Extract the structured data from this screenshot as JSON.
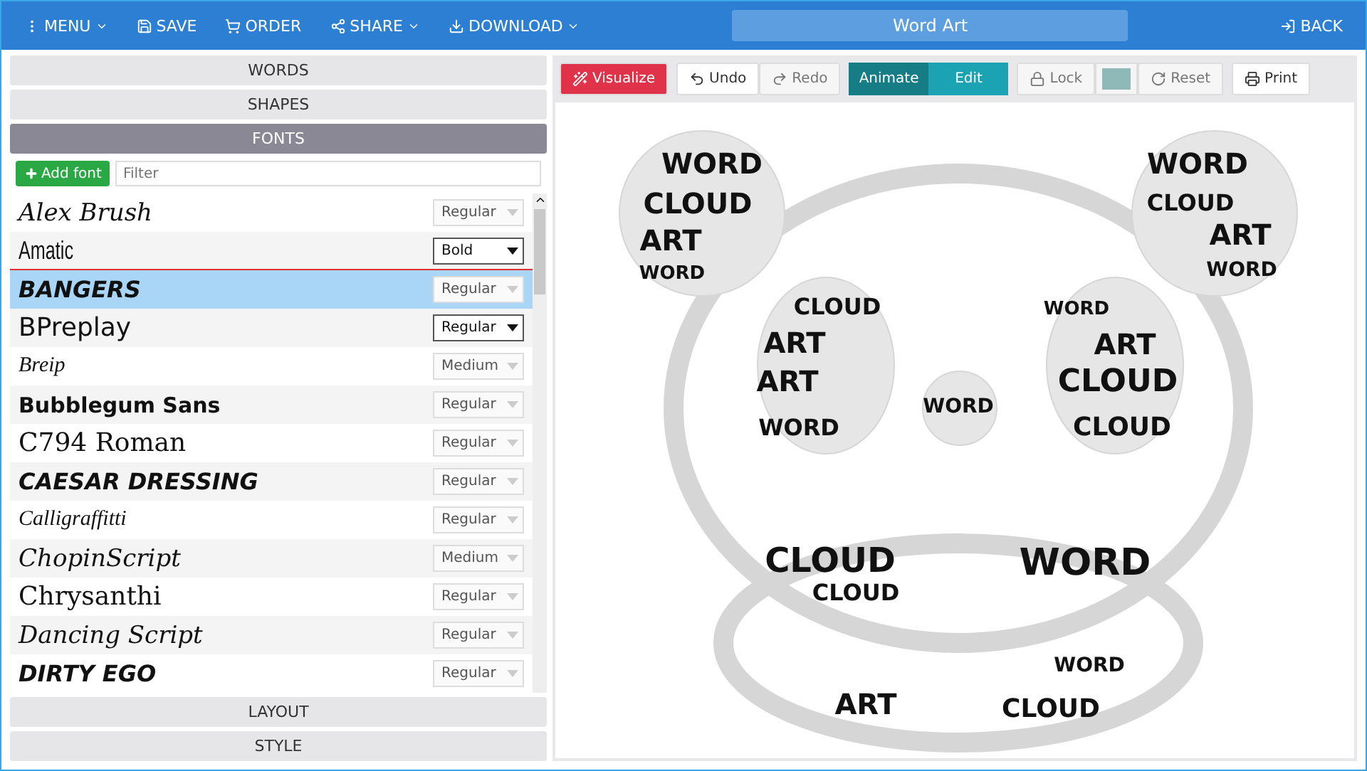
{
  "top_bar": {
    "menu": [
      {
        "label": "MENU",
        "caret": true
      },
      {
        "label": "SAVE",
        "caret": false
      },
      {
        "label": "ORDER",
        "caret": false
      },
      {
        "label": "SHARE",
        "caret": true
      },
      {
        "label": "DOWNLOAD",
        "caret": true
      }
    ],
    "title": "Word Art",
    "back": "BACK"
  },
  "sections_top": [
    {
      "label": "WORDS",
      "expanded": false
    },
    {
      "label": "SHAPES",
      "expanded": false
    },
    {
      "label": "FONTS",
      "expanded": true
    }
  ],
  "fonts_panel": {
    "add_button": "Add font",
    "filter": {
      "placeholder": "Filter"
    },
    "fonts": [
      {
        "name": "Alex Brush",
        "kind": "script",
        "weight": "Regular",
        "selected": false,
        "disabled": true
      },
      {
        "name": "Amatic",
        "kind": "narrow",
        "weight": "Bold",
        "selected": false,
        "disabled": false
      },
      {
        "name": "BANGERS",
        "kind": "display",
        "weight": "Regular",
        "selected": true,
        "disabled": true
      },
      {
        "name": "BPreplay",
        "kind": "sans",
        "weight": "Regular",
        "selected": false,
        "disabled": false
      },
      {
        "name": "Breip",
        "kind": "hand",
        "weight": "Medium",
        "selected": false,
        "disabled": true
      },
      {
        "name": "Bubblegum Sans",
        "kind": "bold",
        "weight": "Regular",
        "selected": false,
        "disabled": true
      },
      {
        "name": "C794 Roman",
        "kind": "serif",
        "weight": "Regular",
        "selected": false,
        "disabled": true
      },
      {
        "name": "CAESAR DRESSING",
        "kind": "display",
        "weight": "Regular",
        "selected": false,
        "disabled": true
      },
      {
        "name": "Calligraffitti",
        "kind": "hand",
        "weight": "Regular",
        "selected": false,
        "disabled": true
      },
      {
        "name": "ChopinScript",
        "kind": "script",
        "weight": "Medium",
        "selected": false,
        "disabled": true
      },
      {
        "name": "Chrysanthi",
        "kind": "serif",
        "weight": "Regular",
        "selected": false,
        "disabled": true
      },
      {
        "name": "Dancing Script",
        "kind": "script",
        "weight": "Regular",
        "selected": false,
        "disabled": true
      },
      {
        "name": "DIRTY EGO",
        "kind": "display",
        "weight": "Regular",
        "selected": false,
        "disabled": true
      }
    ]
  },
  "sections_bottom": [
    {
      "label": "LAYOUT",
      "expanded": false
    },
    {
      "label": "STYLE",
      "expanded": false
    }
  ],
  "toolbar": {
    "visualize": "Visualize",
    "undo": "Undo",
    "redo": "Redo",
    "modes": [
      {
        "label": "Animate",
        "selected": true
      },
      {
        "label": "Edit",
        "selected": false
      }
    ],
    "lock": "Lock",
    "reset": "Reset",
    "print": "Print"
  },
  "canvas": {
    "words": [
      "WORD",
      "WORD",
      "CLOUD",
      "CLOUD",
      "ART",
      "ART",
      "WORD",
      "WORD",
      "CLOUD",
      "WORD",
      "ART",
      "ART",
      "ART",
      "CLOUD",
      "WORD",
      "WORD",
      "CLOUD",
      "CLOUD",
      "WORD",
      "CLOUD",
      "WORD",
      "ART",
      "CLOUD"
    ]
  }
}
